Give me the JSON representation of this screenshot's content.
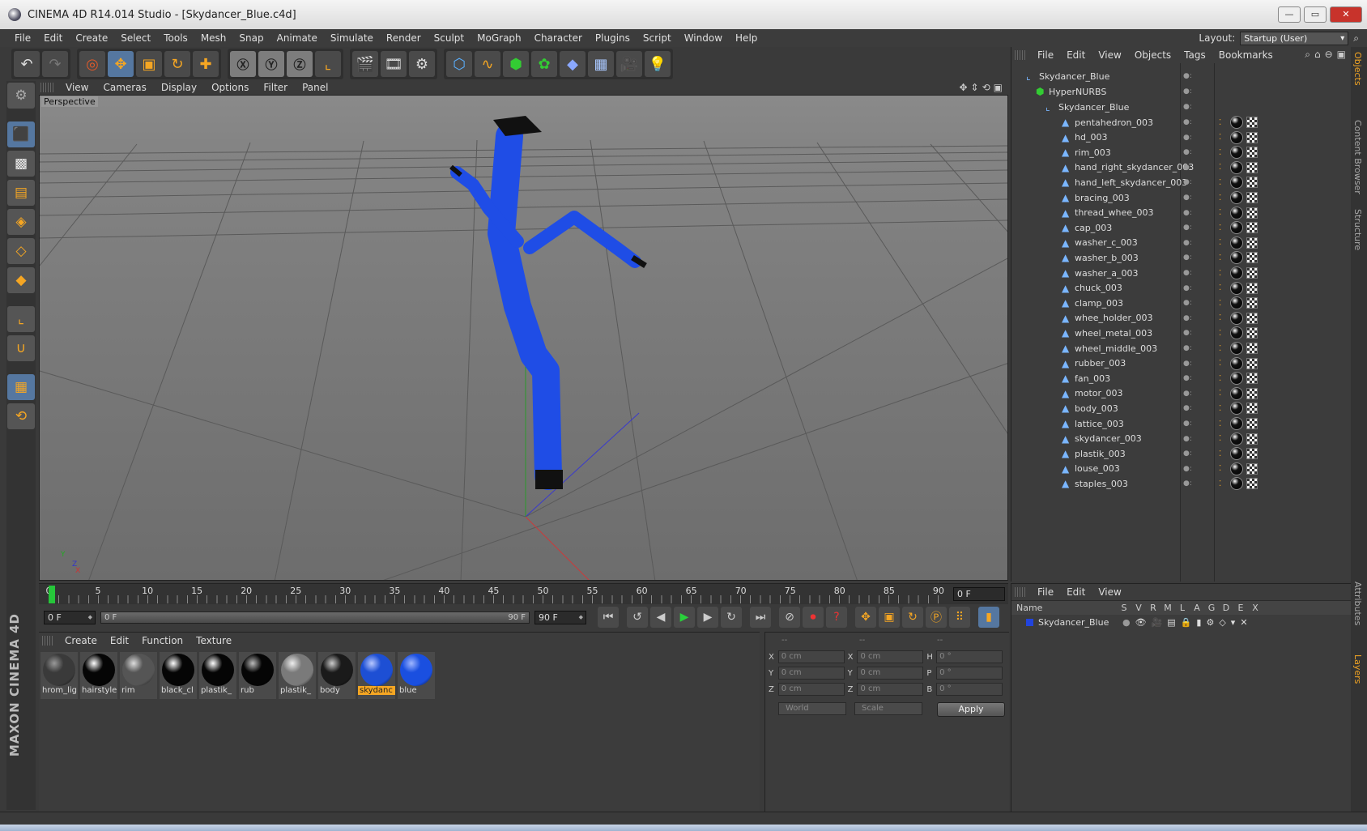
{
  "window": {
    "title": "CINEMA 4D R14.014 Studio - [Skydancer_Blue.c4d]",
    "min": "—",
    "max": "▭",
    "close": "✕"
  },
  "menu": [
    "File",
    "Edit",
    "Create",
    "Select",
    "Tools",
    "Mesh",
    "Snap",
    "Animate",
    "Simulate",
    "Render",
    "Sculpt",
    "MoGraph",
    "Character",
    "Plugins",
    "Script",
    "Window",
    "Help"
  ],
  "layout": {
    "label": "Layout:",
    "value": "Startup (User)"
  },
  "viewport": {
    "menu": [
      "View",
      "Cameras",
      "Display",
      "Options",
      "Filter",
      "Panel"
    ],
    "label": "Perspective",
    "axis": {
      "y": "Y",
      "z": "Z",
      "x": "X"
    }
  },
  "timeline": {
    "ticks": [
      "0",
      "5",
      "10",
      "15",
      "20",
      "25",
      "30",
      "35",
      "40",
      "45",
      "50",
      "55",
      "60",
      "65",
      "70",
      "75",
      "80",
      "85",
      "90"
    ],
    "current_frame": "0 F",
    "start_field": "0 F",
    "range_left": "0 F",
    "range_right": "90 F",
    "end_field": "90 F"
  },
  "materials": {
    "menu": [
      "Create",
      "Edit",
      "Function",
      "Texture"
    ],
    "items": [
      {
        "label": "hrom_lig",
        "color": "#3a3a3a",
        "shine": "#999999"
      },
      {
        "label": "hairstyle",
        "color": "#050505",
        "shine": "#ffffff"
      },
      {
        "label": "rim",
        "color": "#555555",
        "shine": "#dddddd"
      },
      {
        "label": "black_cl",
        "color": "#050505",
        "shine": "#ffffff"
      },
      {
        "label": "plastik_",
        "color": "#050505",
        "shine": "#ffffff"
      },
      {
        "label": "rub",
        "color": "#050505",
        "shine": "#bbbbbb"
      },
      {
        "label": "plastik_",
        "color": "#7a7a7a",
        "shine": "#eeeeee"
      },
      {
        "label": "body",
        "color": "#1a1a1a",
        "shine": "#cccccc"
      },
      {
        "label": "skydanc",
        "color": "#1d4fd4",
        "shine": "#b8c8ff",
        "selected": true
      },
      {
        "label": "blue",
        "color": "#1a4fe0",
        "shine": "#9fb6ff"
      }
    ]
  },
  "coords": {
    "headers": [
      "--",
      "--",
      "--"
    ],
    "rows": [
      {
        "a": "X",
        "av": "0 cm",
        "b": "X",
        "bv": "0 cm",
        "c": "H",
        "cv": "0 °"
      },
      {
        "a": "Y",
        "av": "0 cm",
        "b": "Y",
        "bv": "0 cm",
        "c": "P",
        "cv": "0 °"
      },
      {
        "a": "Z",
        "av": "0 cm",
        "b": "Z",
        "bv": "0 cm",
        "c": "B",
        "cv": "0 °"
      }
    ],
    "mode1": "World",
    "mode2": "Scale",
    "apply": "Apply"
  },
  "objects": {
    "menu": [
      "File",
      "Edit",
      "View",
      "Objects",
      "Tags",
      "Bookmarks"
    ],
    "root": "Skydancer_Blue",
    "hypernurbs": "HyperNURBS",
    "group": "Skydancer_Blue",
    "children": [
      "pentahedron_003",
      "hd_003",
      "rim_003",
      "hand_right_skydancer_003",
      "hand_left_skydancer_003",
      "bracing_003",
      "thread_whee_003",
      "cap_003",
      "washer_c_003",
      "washer_b_003",
      "washer_a_003",
      "chuck_003",
      "clamp_003",
      "whee_holder_003",
      "wheel_metal_003",
      "wheel_middle_003",
      "rubber_003",
      "fan_003",
      "motor_003",
      "body_003",
      "lattice_003",
      "skydancer_003",
      "plastik_003",
      "louse_003",
      "staples_003"
    ]
  },
  "layers": {
    "menu": [
      "File",
      "Edit",
      "View"
    ],
    "columns": [
      "Name",
      "S",
      "V",
      "R",
      "M",
      "L",
      "A",
      "G",
      "D",
      "E",
      "X"
    ],
    "row": "Skydancer_Blue"
  },
  "side_tabs": [
    "Objects",
    "Content Browser",
    "Structure",
    "Attributes",
    "Layers"
  ],
  "brand": {
    "line1": "MAXON",
    "line2": "CINEMA 4D"
  },
  "colors": {
    "accent": "#f5a623",
    "figure": "#1f4de6",
    "playhead": "#26c63a"
  }
}
